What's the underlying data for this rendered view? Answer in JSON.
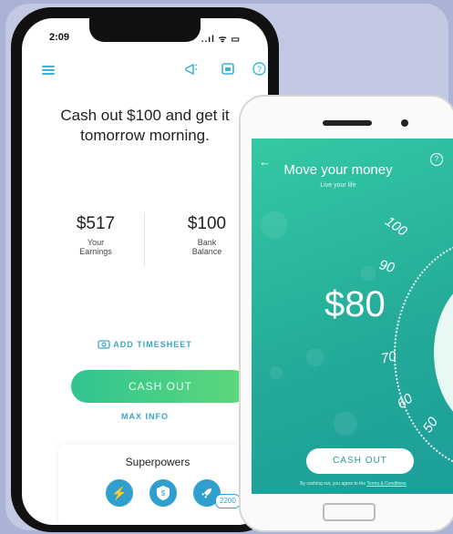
{
  "iphone": {
    "status_time": "2:09",
    "status_right": "..ıl ᯤ ▭",
    "headline": "Cash out $100 and get it tomorrow morning.",
    "earnings_value": "$517",
    "earnings_label": "Your Earnings",
    "bank_value": "$100",
    "bank_label": "Bank Balance",
    "add_timesheet": "ADD TIMESHEET",
    "cash_out": "CASH OUT",
    "max_info": "MAX INFO",
    "superpowers_title": "Superpowers",
    "superpowers_badge": "2200"
  },
  "android": {
    "title": "Move your money",
    "subtitle": "Live your life",
    "amount": "$80",
    "dial_ticks": [
      "100",
      "90",
      "70",
      "60",
      "50"
    ],
    "cash_out": "CASH OUT",
    "terms_prefix": "By cashing out, you agree to the",
    "terms_link": "Terms & Conditions"
  },
  "colors": {
    "accent_blue": "#39b4d6",
    "accent_green": "#31c48f",
    "android_teal": "#23a998"
  }
}
